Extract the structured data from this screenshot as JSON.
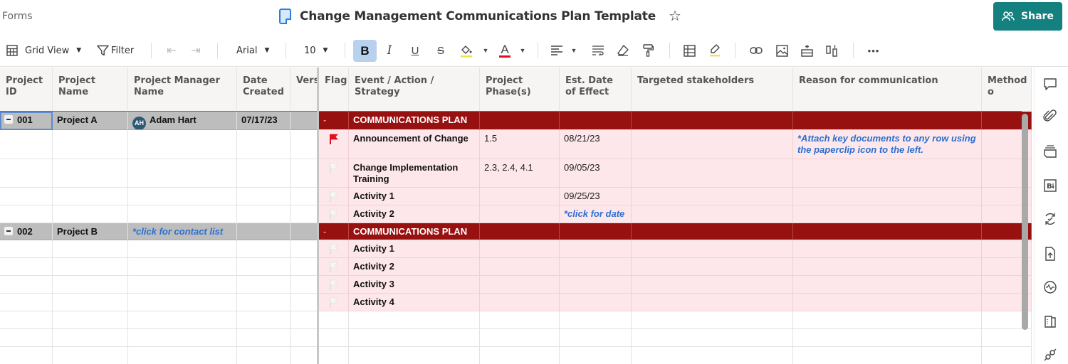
{
  "header": {
    "forms_label": "Forms",
    "title": "Change Management Communications Plan Template",
    "share_label": "Share"
  },
  "toolbar": {
    "view_label": "Grid View",
    "filter_label": "Filter",
    "font_family": "Arial",
    "font_size": "10",
    "bold_label": "B",
    "italic_label": "I",
    "underline_label": "U",
    "strike_label": "S",
    "text_color_label": "A",
    "more_label": "•••"
  },
  "colors": {
    "accent": "#148080",
    "section_row": "#981111",
    "child_row": "#fde7ea",
    "parent_row": "#bdbdbd",
    "hint_text": "#2a6fd1",
    "flag_active": "#e0101e"
  },
  "columns": [
    {
      "key": "project_id",
      "label": "Project ID"
    },
    {
      "key": "project_name",
      "label": "Project Name"
    },
    {
      "key": "project_manager",
      "label": "Project Manager Name"
    },
    {
      "key": "date_created",
      "label": "Date Created"
    },
    {
      "key": "version",
      "label": "Vers"
    },
    {
      "key": "flag",
      "label": "Flag"
    },
    {
      "key": "event",
      "label": "Event / Action / Strategy"
    },
    {
      "key": "phase",
      "label": "Project Phase(s)"
    },
    {
      "key": "est_date",
      "label": "Est. Date of Effect"
    },
    {
      "key": "stakeholders",
      "label": "Targeted stakeholders"
    },
    {
      "key": "reason",
      "label": "Reason for communication"
    },
    {
      "key": "method",
      "label": "Method o"
    }
  ],
  "rows": [
    {
      "type": "parent",
      "project_id": "001",
      "project_name": "Project A",
      "pm_initials": "AH",
      "project_manager": "Adam Hart",
      "date_created": "07/17/23",
      "event": "COMMUNICATIONS PLAN"
    },
    {
      "type": "child",
      "flag": "flagged",
      "event": "Announcement of Change",
      "phase": "1.5",
      "est_date": "08/21/23",
      "reason": "*Attach key documents to any row using the paperclip icon to the left."
    },
    {
      "type": "child",
      "flag": "unflagged",
      "event": "Change Implementation Training",
      "phase": "2.3, 2.4, 4.1",
      "est_date": "09/05/23"
    },
    {
      "type": "child",
      "flag": "unflagged",
      "event": "Activity 1",
      "est_date": "09/25/23"
    },
    {
      "type": "child",
      "flag": "unflagged",
      "event": "Activity 2",
      "est_date_hint": "*click for date"
    },
    {
      "type": "parent",
      "project_id": "002",
      "project_name": "Project B",
      "pm_hint": "*click for contact list",
      "event": "COMMUNICATIONS PLAN"
    },
    {
      "type": "child",
      "flag": "unflagged",
      "event": "Activity 1"
    },
    {
      "type": "child",
      "flag": "unflagged",
      "event": "Activity 2"
    },
    {
      "type": "child",
      "flag": "unflagged",
      "event": "Activity 3"
    },
    {
      "type": "child",
      "flag": "unflagged",
      "event": "Activity 4"
    }
  ],
  "right_rail": [
    "comments-icon",
    "attachments-icon",
    "proofing-icon",
    "briefcase-icon",
    "update-requests-icon",
    "publish-icon",
    "activity-log-icon",
    "summary-icon",
    "connections-icon"
  ]
}
